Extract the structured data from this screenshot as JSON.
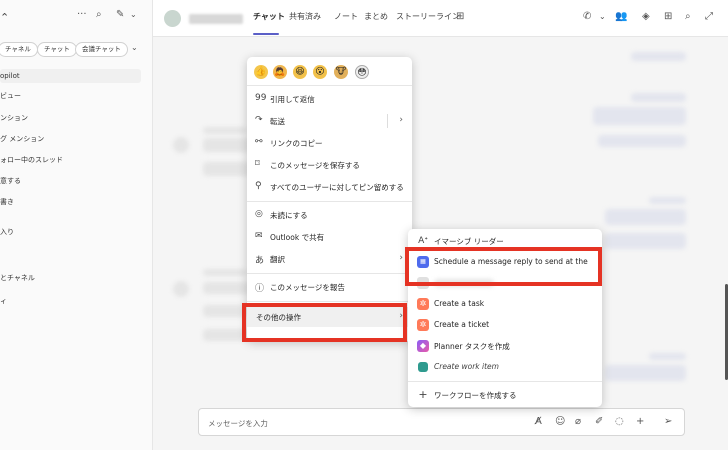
{
  "sidebar": {
    "chips": [
      "チャネル",
      "チャット",
      "会議チャット"
    ],
    "items": [
      "opilot",
      "ビュー",
      "ンション",
      "グ メンション",
      "ォロー中のスレッド",
      "意する",
      "書き",
      "入り",
      "とチャネル",
      "ィ"
    ]
  },
  "header": {
    "tabs": [
      "チャット",
      "共有済み",
      "ノート",
      "まとめ",
      "ストーリーライン"
    ]
  },
  "context_menu": {
    "emojis": [
      "👍",
      "🙇",
      "😆",
      "😮",
      "🐮",
      "😳"
    ],
    "items": [
      {
        "icon": "quote-icon",
        "glyph": "99",
        "label": "引用して返信"
      },
      {
        "icon": "forward-icon",
        "glyph": "↷",
        "label": "転送"
      },
      {
        "icon": "link-icon",
        "glyph": "⚯",
        "label": "リンクのコピー"
      },
      {
        "icon": "bookmark-icon",
        "glyph": "⌑",
        "label": "このメッセージを保存する"
      },
      {
        "icon": "pin-icon",
        "glyph": "⚲",
        "label": "すべてのユーザーに対してピン留めする"
      },
      {
        "icon": "unread-icon",
        "glyph": "◎",
        "label": "未読にする"
      },
      {
        "icon": "outlook-icon",
        "glyph": "✉",
        "label": "Outlook で共有"
      },
      {
        "icon": "translate-icon",
        "glyph": "あ",
        "label": "翻訳"
      },
      {
        "icon": "report-icon",
        "glyph": "ⓘ",
        "label": "このメッセージを報告"
      },
      {
        "icon": "more-actions-icon",
        "glyph": "",
        "label": "その他の操作"
      }
    ]
  },
  "submenu": {
    "items": [
      {
        "icon": "immersive-reader-icon",
        "label": "イマーシブ リーダー",
        "italic": false
      },
      {
        "icon": "schedule-message-icon",
        "label": "Schedule a message reply to send at the",
        "italic": false
      },
      {
        "icon": "blurred-item-icon",
        "label": "",
        "italic": false
      },
      {
        "icon": "hubspot-task-icon",
        "label": "Create a task",
        "italic": false
      },
      {
        "icon": "hubspot-ticket-icon",
        "label": "Create a ticket",
        "italic": false
      },
      {
        "icon": "planner-icon",
        "label": "Planner タスクを作成",
        "italic": false
      },
      {
        "icon": "work-item-icon",
        "label": "Create work item",
        "italic": true
      },
      {
        "icon": "plus-icon",
        "label": "ワークフローを作成する",
        "italic": false
      }
    ]
  },
  "compose": {
    "placeholder": "メッセージを入力"
  },
  "colors": {
    "accent": "#5b5fc7",
    "highlight": "#e53324",
    "hubspot": "#ff7a59"
  }
}
